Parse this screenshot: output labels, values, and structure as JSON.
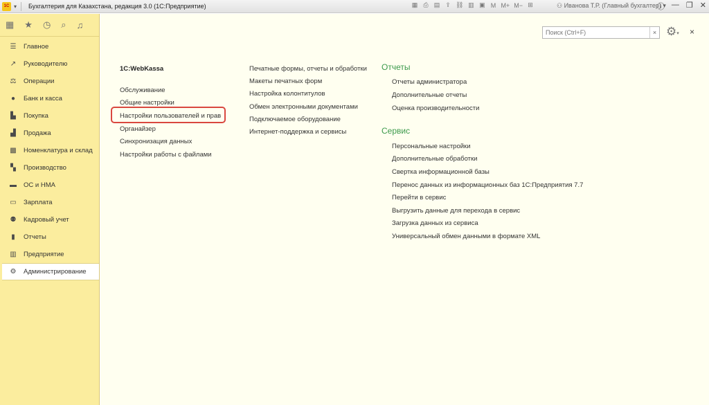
{
  "titlebar": {
    "logo": "1С",
    "title": "Бухгалтерия для Казахстана, редакция 3.0  (1С:Предприятие)",
    "tools": [
      "M",
      "M+",
      "M−"
    ],
    "user": "Иванова Т.Р. (Главный бухгалтер)"
  },
  "sidebar": {
    "items": [
      {
        "label": "Главное",
        "icon": "menu-icon"
      },
      {
        "label": "Руководителю",
        "icon": "trend-icon"
      },
      {
        "label": "Операции",
        "icon": "operations-icon"
      },
      {
        "label": "Банк и касса",
        "icon": "bank-icon"
      },
      {
        "label": "Покупка",
        "icon": "cart-icon"
      },
      {
        "label": "Продажа",
        "icon": "bag-icon"
      },
      {
        "label": "Номенклатура и склад",
        "icon": "warehouse-icon"
      },
      {
        "label": "Производство",
        "icon": "factory-icon"
      },
      {
        "label": "ОС и НМА",
        "icon": "truck-icon"
      },
      {
        "label": "Зарплата",
        "icon": "salary-icon"
      },
      {
        "label": "Кадровый учет",
        "icon": "people-icon"
      },
      {
        "label": "Отчеты",
        "icon": "report-icon"
      },
      {
        "label": "Предприятие",
        "icon": "company-icon"
      },
      {
        "label": "Администрирование",
        "icon": "gear-icon",
        "active": true
      }
    ]
  },
  "search": {
    "placeholder": "Поиск (Ctrl+F)",
    "clear": "×"
  },
  "columns": {
    "col1": {
      "heading": "1С:WebKassa",
      "links": [
        "Обслуживание",
        "Общие настройки",
        "Настройки пользователей и прав",
        "Органайзер",
        "Синхронизация данных",
        "Настройки работы с файлами"
      ]
    },
    "col2": {
      "links": [
        "Печатные формы, отчеты и обработки",
        "Макеты печатных форм",
        "Настройка колонтитулов",
        "Обмен электронными документами",
        "Подключаемое оборудование",
        "Интернет-поддержка и сервисы"
      ]
    },
    "col3": {
      "group1": "Отчеты",
      "group1_links": [
        "Отчеты администратора",
        "Дополнительные отчеты",
        "Оценка производительности"
      ],
      "group2": "Сервис",
      "group2_links": [
        "Персональные настройки",
        "Дополнительные обработки",
        "Свертка информационной базы",
        "Перенос данных из информационных баз 1С:Предприятия 7.7",
        "Перейти в сервис",
        "Выгрузить данные для перехода в сервис",
        "Загрузка данных из сервиса",
        "Универсальный обмен данными в формате XML"
      ]
    }
  }
}
